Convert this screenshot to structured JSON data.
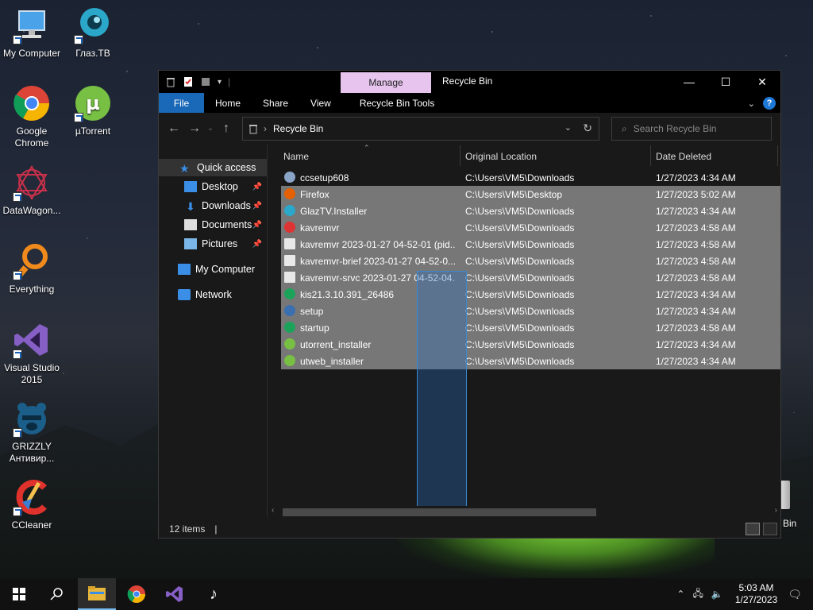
{
  "desktop": {
    "icons": [
      {
        "label": "My Computer"
      },
      {
        "label": "Глаз.ТВ"
      },
      {
        "label": "Google Chrome"
      },
      {
        "label": "µTorrent"
      },
      {
        "label": "DataWagon..."
      },
      {
        "label": "Everything"
      },
      {
        "label": "Visual Studio 2015"
      },
      {
        "label": "GRIZZLY Антивир..."
      },
      {
        "label": "CCleaner"
      }
    ],
    "recycle_partial_label": "Bin"
  },
  "window": {
    "title": "Recycle Bin",
    "contextual_tab": "Manage",
    "ribbon_tabs": [
      "File",
      "Home",
      "Share",
      "View",
      "Recycle Bin Tools"
    ],
    "caption": {
      "minimize": "—",
      "maximize": "☐",
      "close": "✕"
    },
    "address": {
      "location": "Recycle Bin"
    },
    "search": {
      "placeholder": "Search Recycle Bin"
    },
    "nav": {
      "quick_access": "Quick access",
      "desktop": "Desktop",
      "downloads": "Downloads",
      "documents": "Documents",
      "pictures": "Pictures",
      "my_computer": "My Computer",
      "network": "Network"
    },
    "columns": {
      "name": "Name",
      "location": "Original Location",
      "date": "Date Deleted"
    },
    "files": [
      {
        "name": "ccsetup608",
        "location": "C:\\Users\\VM5\\Downloads",
        "date": "1/27/2023 4:34 AM",
        "icon": "installer-icon"
      },
      {
        "name": "Firefox",
        "location": "C:\\Users\\VM5\\Desktop",
        "date": "1/27/2023 5:02 AM",
        "icon": "firefox-icon"
      },
      {
        "name": "GlazTV.Installer",
        "location": "C:\\Users\\VM5\\Downloads",
        "date": "1/27/2023 4:34 AM",
        "icon": "glaztv-icon"
      },
      {
        "name": "kavremvr",
        "location": "C:\\Users\\VM5\\Downloads",
        "date": "1/27/2023 4:58 AM",
        "icon": "kavremvr-icon"
      },
      {
        "name": "kavremvr 2023-01-27 04-52-01 (pid...",
        "location": "C:\\Users\\VM5\\Downloads",
        "date": "1/27/2023 4:58 AM",
        "icon": "text-file-icon"
      },
      {
        "name": "kavremvr-brief 2023-01-27 04-52-0...",
        "location": "C:\\Users\\VM5\\Downloads",
        "date": "1/27/2023 4:58 AM",
        "icon": "text-file-icon"
      },
      {
        "name": "kavremvr-srvc 2023-01-27 04-52-04...",
        "location": "C:\\Users\\VM5\\Downloads",
        "date": "1/27/2023 4:58 AM",
        "icon": "text-file-icon"
      },
      {
        "name": "kis21.3.10.391_26486",
        "location": "C:\\Users\\VM5\\Downloads",
        "date": "1/27/2023 4:34 AM",
        "icon": "kaspersky-icon"
      },
      {
        "name": "setup",
        "location": "C:\\Users\\VM5\\Downloads",
        "date": "1/27/2023 4:34 AM",
        "icon": "setup-icon"
      },
      {
        "name": "startup",
        "location": "C:\\Users\\VM5\\Downloads",
        "date": "1/27/2023 4:58 AM",
        "icon": "kaspersky-icon"
      },
      {
        "name": "utorrent_installer",
        "location": "C:\\Users\\VM5\\Downloads",
        "date": "1/27/2023 4:34 AM",
        "icon": "utorrent-icon"
      },
      {
        "name": "utweb_installer",
        "location": "C:\\Users\\VM5\\Downloads",
        "date": "1/27/2023 4:34 AM",
        "icon": "utorrent-icon"
      }
    ],
    "status": {
      "count": "12 items"
    }
  },
  "taskbar": {
    "time": "5:03 AM",
    "date": "1/27/2023"
  },
  "colors": {
    "accent": "#1a69b8",
    "manage_tab": "#e6c4ee",
    "selection": "#777777",
    "window_bg": "#191919"
  }
}
